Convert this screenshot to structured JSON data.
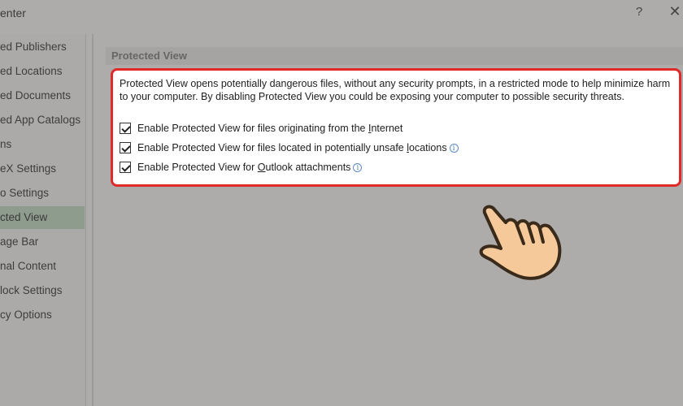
{
  "window": {
    "title": "enter",
    "help_label": "?",
    "close_label": "✕"
  },
  "sidebar": {
    "items": [
      {
        "label": "ed Publishers"
      },
      {
        "label": "ed Locations"
      },
      {
        "label": "ed Documents"
      },
      {
        "label": "ed App Catalogs"
      },
      {
        "label": "ns"
      },
      {
        "label": "eX Settings"
      },
      {
        "label": "o Settings"
      },
      {
        "label": "cted View",
        "selected": true
      },
      {
        "label": "age Bar"
      },
      {
        "label": "nal Content"
      },
      {
        "label": "lock Settings"
      },
      {
        "label": "cy Options"
      }
    ]
  },
  "protected_view": {
    "section_title": "Protected View",
    "description": "Protected View opens potentially dangerous files, without any security prompts, in a restricted mode to help minimize harm to your computer. By disabling Protected View you could be exposing your computer to possible security threats.",
    "options": [
      {
        "label_pre": "Enable Protected View for files originating from the ",
        "accel": "I",
        "label_post": "nternet",
        "checked": true,
        "info": false
      },
      {
        "label_pre": "Enable Protected View for files located in potentially unsafe ",
        "accel": "l",
        "label_post": "ocations",
        "checked": true,
        "info": true
      },
      {
        "label_pre": "Enable Protected View for ",
        "accel": "O",
        "label_post": "utlook attachments",
        "checked": true,
        "info": true
      }
    ],
    "info_glyph": "i"
  },
  "colors": {
    "highlight_border": "#e02a2a",
    "selected_item": "#8e9c8d",
    "hand_fill": "#f6c99b"
  },
  "icons": {
    "pointer": "pointing-hand-icon"
  }
}
